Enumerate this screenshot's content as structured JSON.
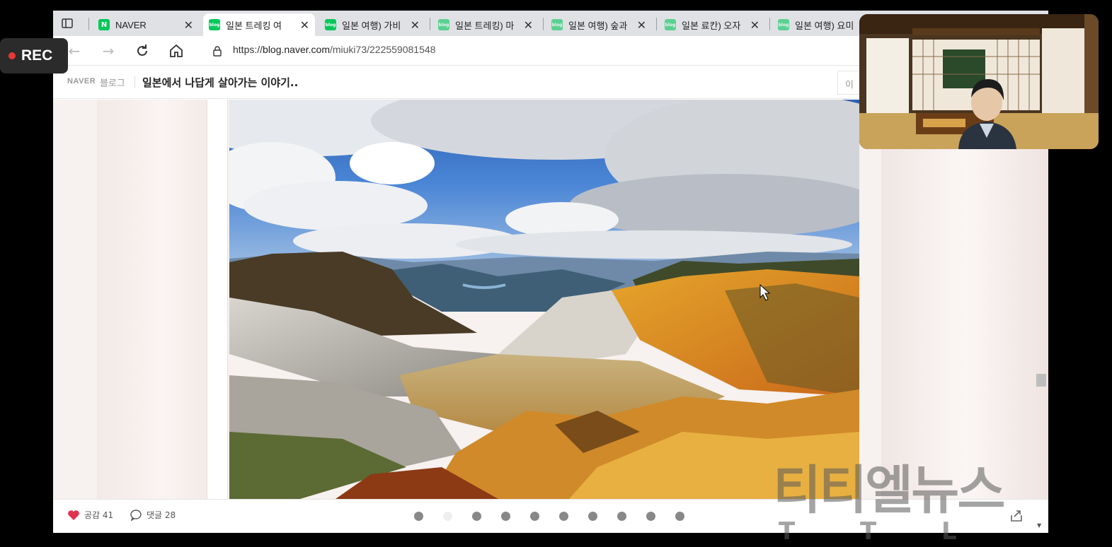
{
  "recording": {
    "label": "REC"
  },
  "browser": {
    "tabs": [
      {
        "label": "NAVER",
        "favicon": "N"
      },
      {
        "label": "일본 트레킹 여",
        "favicon": "blog",
        "active": true
      },
      {
        "label": "일본 여행) 가비",
        "favicon": "blog"
      },
      {
        "label": "일본 트레킹) 마",
        "favicon": "blog"
      },
      {
        "label": "일본 여행) 숲과",
        "favicon": "blog"
      },
      {
        "label": "일본 료칸) 오자",
        "favicon": "blog"
      },
      {
        "label": "일본 여행) 요미",
        "favicon": "blog"
      }
    ],
    "address": {
      "prefix": "https://",
      "host": "blog.naver.com",
      "path": "/miuki73/222559081548"
    }
  },
  "blog": {
    "brand": "NAVER",
    "section": "블로그",
    "title": "일본에서 나답게 살아가는 이야기..",
    "search_placeholder": "이"
  },
  "post_footer": {
    "like_label": "공감",
    "like_count": "41",
    "comment_label": "댓글",
    "comment_count": "28",
    "slide_count": 10,
    "current_slide": 2
  },
  "watermark": {
    "text": "티티엘뉴스",
    "sub": "T T L"
  },
  "colors": {
    "naver_green": "#03c75a",
    "heart": "#e0324f",
    "rec_red": "#e53935"
  }
}
